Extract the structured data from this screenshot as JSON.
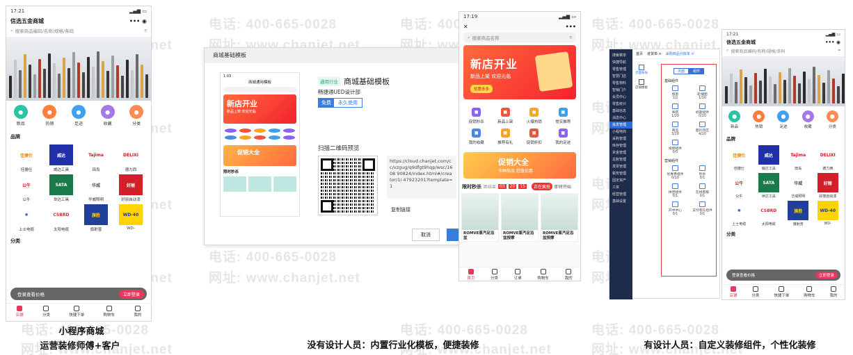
{
  "watermark": {
    "tel": "电话: 400-665-0028",
    "site": "网址: www.chanjet.net"
  },
  "p1": {
    "status_time": "17:21",
    "title": "信选五金商城",
    "search_placeholder": "搜索商品编码/名称/规格/条码",
    "icons": [
      {
        "label": "新品",
        "color": "#2cc2a4"
      },
      {
        "label": "热销",
        "color": "#ff7e3b"
      },
      {
        "label": "足迹",
        "color": "#3fa0f0"
      },
      {
        "label": "收藏",
        "color": "#a678e8"
      },
      {
        "label": "分类",
        "color": "#ff8a54"
      }
    ],
    "brand_title": "品牌",
    "brands": [
      {
        "logo": "佳捷仕",
        "name": "佳捷仕",
        "bg": "#fff",
        "fg": "#e08a17"
      },
      {
        "logo": "威达",
        "name": "威达工具",
        "bg": "#2130a8",
        "fg": "#fff"
      },
      {
        "logo": "Tajima",
        "name": "田岛",
        "bg": "#fff",
        "fg": "#d0161e"
      },
      {
        "logo": "DELIXI",
        "name": "德力西",
        "bg": "#fff",
        "fg": "#d0161e"
      },
      {
        "logo": "公牛",
        "name": "公牛",
        "bg": "#fff",
        "fg": "#d0161e"
      },
      {
        "logo": "SATA",
        "name": "世达工具",
        "bg": "#1a7a4a",
        "fg": "#fff"
      },
      {
        "logo": "华威",
        "name": "华威照明",
        "bg": "#fff",
        "fg": "#555"
      },
      {
        "logo": "好丽",
        "name": "好丽自动漆",
        "bg": "#d21f2a",
        "fg": "#fff"
      },
      {
        "logo": "✺",
        "name": "上士电缆",
        "bg": "#fff",
        "fg": "#1a5fc0"
      },
      {
        "logo": "CSBRD",
        "name": "太阳电缆",
        "bg": "#fff",
        "fg": "#c83030"
      },
      {
        "logo": "旗胜",
        "name": "旗射普",
        "bg": "#20409a",
        "fg": "#ffd400"
      },
      {
        "logo": "WD-40",
        "name": "WD-",
        "bg": "#ffd400",
        "fg": "#1a3a9a"
      }
    ],
    "cat_title": "分类",
    "bar_text": "登录查看价格",
    "bar_btn": "立即登录",
    "tabs": [
      "店铺",
      "分类",
      "快捷下单",
      "购物车",
      "我的"
    ]
  },
  "caption1": {
    "line1": "小程序商城",
    "line2": "运营装修师傅+客户"
  },
  "dialog": {
    "title": "商城基础模板",
    "tag": "通用行业",
    "tpl_title": "商城基础模板",
    "author": "畅捷通UED设计部",
    "seg": [
      "免费",
      "永久使用"
    ],
    "qr_label": "扫描二维码预览",
    "url": "https://cloud.chanjet.com/cc/vzgug/q9dfgt9hqp/wsc/1608 90824/index.html#/creator/1i 47923201?template=1",
    "copy": "复制链接",
    "cancel": "取消",
    "mini_title": "商城通用模板",
    "mini_banner": "新店开业",
    "mini_sub": "新品上架 欢迎光临",
    "mini_promo": "促销大全",
    "mini_flash": "限时秒杀"
  },
  "p2": {
    "status_time": "17:19",
    "search_placeholder": "搜索商品名称",
    "banner_title": "新店开业",
    "banner_sub": "新品上架 欢迎光临",
    "banner_btn": "优惠多多",
    "icons": [
      {
        "label": "促销秒杀",
        "color": "#8a63f2"
      },
      {
        "label": "新品上架",
        "color": "#f5523b"
      },
      {
        "label": "火爆热销",
        "color": "#f5a623"
      },
      {
        "label": "常买推荐",
        "color": "#3aa0f0"
      },
      {
        "label": "我的收藏",
        "color": "#4a87e8"
      },
      {
        "label": "推荐有礼",
        "color": "#f5a623"
      },
      {
        "label": "促销折扣",
        "color": "#f5523b"
      },
      {
        "label": "我的足迹",
        "color": "#8a63f2"
      }
    ],
    "promo_title": "促销大全",
    "promo_sub": "多种商品 超值优惠",
    "flash_title": "限时秒杀",
    "flash_label": "距结束",
    "flash_time": [
      "03",
      "20",
      "15"
    ],
    "flash_tab1": "正在疯抢",
    "flash_tab2": "即将开始",
    "products": [
      "ROMVE蒸汽足浴盆",
      "ROMVE蒸汽足浴盆按摩",
      "ROMVE蒸汽足浴盆按摩"
    ],
    "tabs": [
      "首页",
      "分类",
      "订单",
      "购物车",
      "我的"
    ]
  },
  "caption2": "没有设计人员：内置行业化模板，便捷装修",
  "editor": {
    "menu": [
      "搜索菜单",
      "快捷导航",
      "零售管理",
      "智慧门店",
      "零售物料",
      "智销门户",
      "会员中心",
      "零售统计",
      "基础信息",
      "消息中心",
      "批发管理",
      "小程电商",
      "采购管理",
      "库存管理",
      "资金管理",
      "总账管理",
      "发票管理",
      "税务管理",
      "固定资产",
      "工资",
      "经营管理",
      "基础设置"
    ],
    "tabs": [
      "首页",
      "进货单 ×",
      "采购商品分拣单 ×"
    ],
    "side": [
      "页面布局",
      "店铺模板"
    ],
    "panel_tabs": [
      "页面",
      "组件"
    ],
    "group1": "基础组件",
    "comps1": [
      {
        "n": "搜索",
        "c": "1/2"
      },
      {
        "n": "轮播图",
        "c": "1/10"
      },
      {
        "n": "导航",
        "c": "1/20"
      },
      {
        "n": "标题组件",
        "c": "0/20"
      },
      {
        "n": "商品",
        "c": "3/20"
      },
      {
        "n": "图片热区",
        "c": "4/20"
      },
      {
        "n": "视频组件",
        "c": "0/5"
      }
    ],
    "group2": "营销组件",
    "comps2": [
      {
        "n": "优惠券组件",
        "c": "0/10"
      },
      {
        "n": "秒杀",
        "c": "0/1"
      },
      {
        "n": "拼团组件",
        "c": "0/1"
      },
      {
        "n": "在线客服",
        "c": "0/1"
      },
      {
        "n": "开中中心",
        "c": "0/1"
      },
      {
        "n": "支付有礼组件",
        "c": "0/1"
      }
    ]
  },
  "p3": {
    "status_time": "17:21",
    "title": "信选五金商城",
    "search_placeholder": "搜索商品编码/名称/规格/条码",
    "brand_title": "品牌",
    "cat_title": "分类",
    "bar_text": "登录查看价格",
    "bar_btn": "立即登录",
    "tabs": [
      "店铺",
      "分类",
      "快捷下单",
      "购物车",
      "我的"
    ]
  },
  "caption3": "有设计人员：自定义装修组件，个性化装修"
}
